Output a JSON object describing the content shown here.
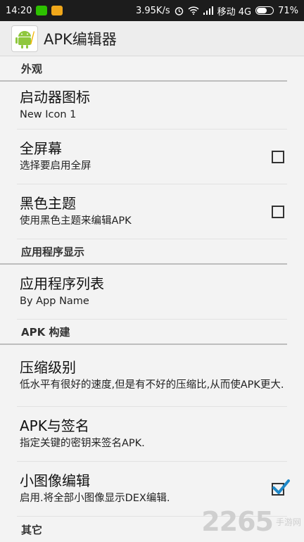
{
  "statusbar": {
    "time": "14:20",
    "speed": "3.95K/s",
    "carrier": "移动 4G",
    "battery": "71%",
    "battery_level": 0.71
  },
  "appbar": {
    "title": "APK编辑器",
    "icon": "android-edit-icon"
  },
  "sections": {
    "appearance": "外观",
    "app_display": "应用程序显示",
    "apk_build": "APK 构建",
    "other": "其它"
  },
  "prefs": {
    "launcher_icon": {
      "title": "启动器图标",
      "summary": "New Icon 1"
    },
    "fullscreen": {
      "title": "全屏幕",
      "summary": "选择要启用全屏",
      "checked": false
    },
    "dark_theme": {
      "title": "黑色主题",
      "summary": "使用黑色主题来编辑APK",
      "checked": false
    },
    "app_list": {
      "title": "应用程序列表",
      "summary": "By App Name"
    },
    "compress_level": {
      "title": "压缩级别",
      "summary": "低水平有很好的速度,但是有不好的压缩比,从而使APK更大."
    },
    "apk_sign": {
      "title": "APK与签名",
      "summary": "指定关键的密钥来签名APK."
    },
    "smali_edit": {
      "title": "小图像编辑",
      "summary": "启用.将全部小图像显示DEX编辑.",
      "checked": true
    }
  },
  "watermark": {
    "number": "2265",
    "site": "手游网"
  },
  "colors": {
    "check_accent": "#1e88c8",
    "statusbar": "#1c1c1c"
  }
}
